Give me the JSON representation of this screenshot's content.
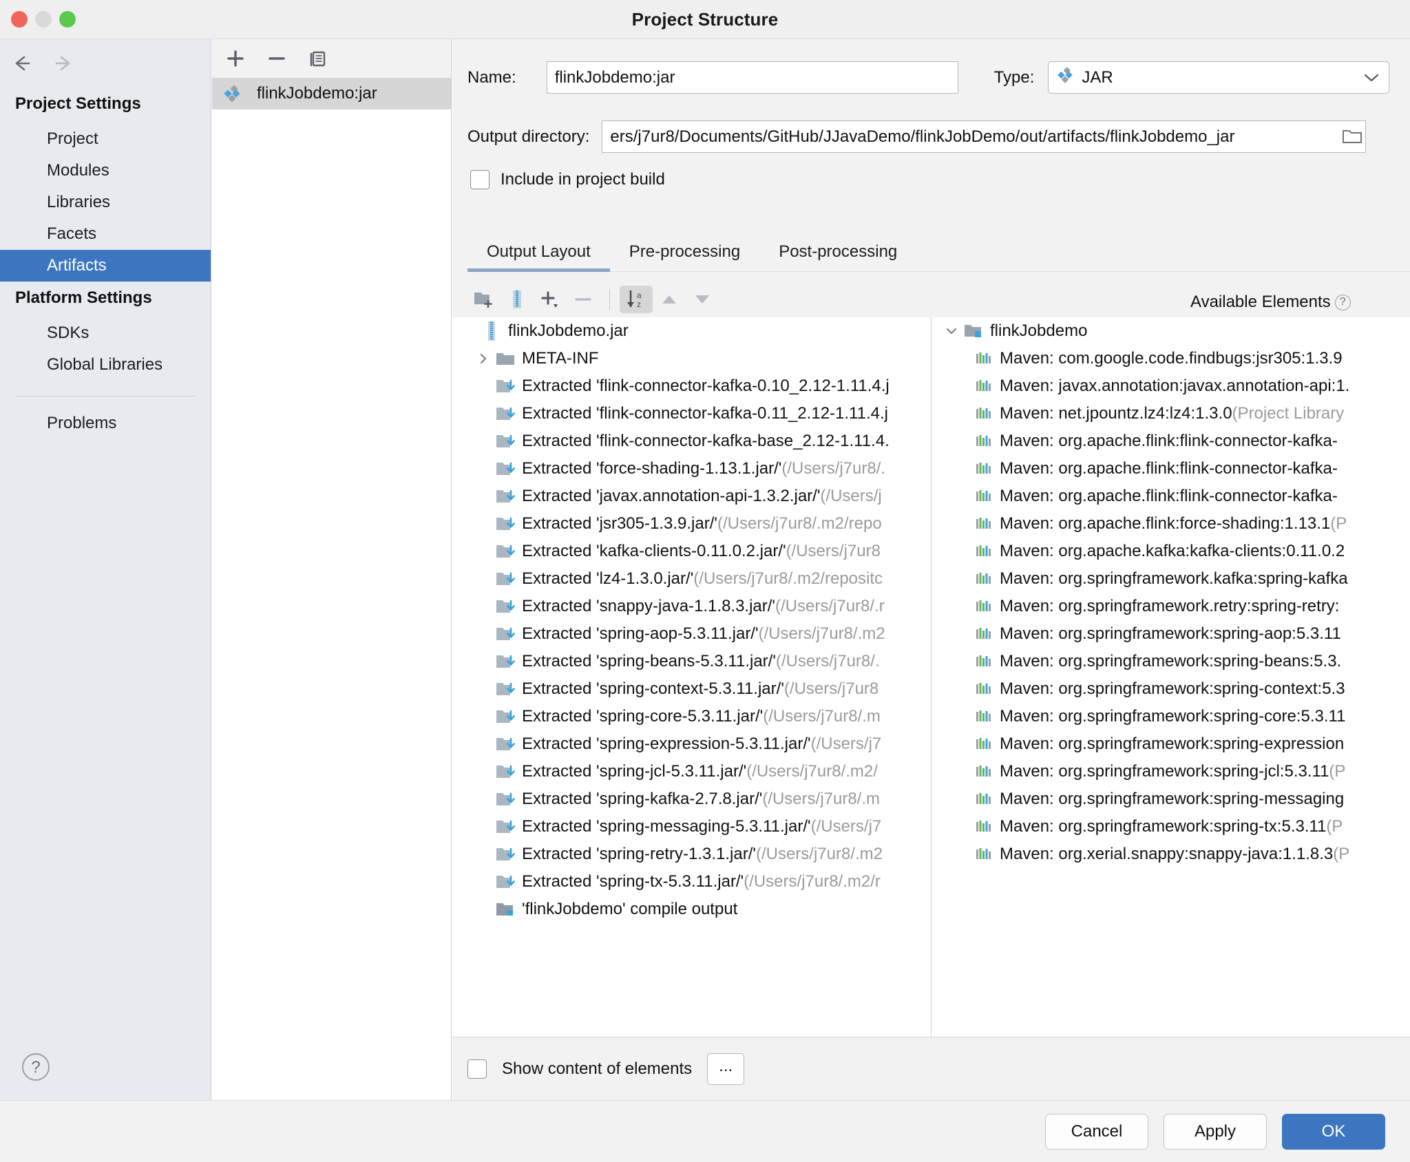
{
  "window": {
    "title": "Project Structure",
    "traffic_lights": [
      "close",
      "minimize",
      "maximize"
    ]
  },
  "sidebar": {
    "nav": {
      "back": "back-arrow",
      "forward": "forward-arrow"
    },
    "groups": [
      {
        "heading": "Project Settings",
        "items": [
          {
            "label": "Project",
            "selected": false
          },
          {
            "label": "Modules",
            "selected": false
          },
          {
            "label": "Libraries",
            "selected": false
          },
          {
            "label": "Facets",
            "selected": false
          },
          {
            "label": "Artifacts",
            "selected": true
          }
        ]
      },
      {
        "heading": "Platform Settings",
        "items": [
          {
            "label": "SDKs",
            "selected": false
          },
          {
            "label": "Global Libraries",
            "selected": false
          }
        ]
      }
    ],
    "extra_items": [
      {
        "label": "Problems",
        "selected": false
      }
    ],
    "help_label": "?"
  },
  "artifact_list": {
    "toolbar": [
      {
        "name": "add-artifact-button",
        "glyph": "+"
      },
      {
        "name": "remove-artifact-button",
        "glyph": "−"
      },
      {
        "name": "copy-artifact-button",
        "glyph": "copy"
      }
    ],
    "items": [
      {
        "label": "flinkJobdemo:jar",
        "selected": true,
        "icon": "artifact-icon"
      }
    ]
  },
  "details": {
    "name_label": "Name:",
    "name_value": "flinkJobdemo:jar",
    "type_label": "Type:",
    "type_value": "JAR",
    "output_dir_label": "Output directory:",
    "output_dir_value": "ers/j7ur8/Documents/GitHub/JJavaDemo/flinkJobDemo/out/artifacts/flinkJobdemo_jar",
    "include_in_build_label": "Include in project build",
    "include_in_build_checked": false,
    "tabs": [
      {
        "label": "Output Layout",
        "active": true
      },
      {
        "label": "Pre-processing",
        "active": false
      },
      {
        "label": "Post-processing",
        "active": false
      }
    ]
  },
  "layout_toolbar": [
    {
      "name": "create-directory-button",
      "glyph": "folder-plus"
    },
    {
      "name": "create-archive-button",
      "glyph": "archive"
    },
    {
      "name": "add-copy-of-button",
      "glyph": "plus-dropdown"
    },
    {
      "name": "remove-element-button",
      "glyph": "minus"
    },
    {
      "name": "sort-alphabetically-button",
      "glyph": "sort-az",
      "active": true
    },
    {
      "name": "move-up-button",
      "glyph": "triangle-up"
    },
    {
      "name": "move-down-button",
      "glyph": "triangle-down"
    }
  ],
  "available_elements": {
    "title": "Available Elements",
    "help_glyph": "?",
    "root": {
      "label": "flinkJobdemo",
      "expanded": true,
      "icon": "module-folder-icon"
    },
    "items": [
      {
        "label": "Maven: com.google.code.findbugs:jsr305:1.3.9",
        "suffix": ""
      },
      {
        "label": "Maven: javax.annotation:javax.annotation-api:1.",
        "suffix": ""
      },
      {
        "label": "Maven: net.jpountz.lz4:lz4:1.3.0",
        "suffix": " (Project Library"
      },
      {
        "label": "Maven: org.apache.flink:flink-connector-kafka-",
        "suffix": ""
      },
      {
        "label": "Maven: org.apache.flink:flink-connector-kafka-",
        "suffix": ""
      },
      {
        "label": "Maven: org.apache.flink:flink-connector-kafka-",
        "suffix": ""
      },
      {
        "label": "Maven: org.apache.flink:force-shading:1.13.1",
        "suffix": " (P"
      },
      {
        "label": "Maven: org.apache.kafka:kafka-clients:0.11.0.2",
        "suffix": ""
      },
      {
        "label": "Maven: org.springframework.kafka:spring-kafka",
        "suffix": ""
      },
      {
        "label": "Maven: org.springframework.retry:spring-retry:",
        "suffix": ""
      },
      {
        "label": "Maven: org.springframework:spring-aop:5.3.11",
        "suffix": ""
      },
      {
        "label": "Maven: org.springframework:spring-beans:5.3.",
        "suffix": ""
      },
      {
        "label": "Maven: org.springframework:spring-context:5.3",
        "suffix": ""
      },
      {
        "label": "Maven: org.springframework:spring-core:5.3.11",
        "suffix": ""
      },
      {
        "label": "Maven: org.springframework:spring-expression",
        "suffix": ""
      },
      {
        "label": "Maven: org.springframework:spring-jcl:5.3.11",
        "suffix": " (P"
      },
      {
        "label": "Maven: org.springframework:spring-messaging",
        "suffix": ""
      },
      {
        "label": "Maven: org.springframework:spring-tx:5.3.11",
        "suffix": " (P"
      },
      {
        "label": "Maven: org.xerial.snappy:snappy-java:1.1.8.3",
        "suffix": " (P"
      }
    ]
  },
  "output_layout_tree": [
    {
      "icon": "archive-icon",
      "indent": 0,
      "twisty": "none",
      "label": "flinkJobdemo.jar",
      "dim": ""
    },
    {
      "icon": "folder-icon",
      "indent": 1,
      "twisty": "collapsed",
      "label": "META-INF",
      "dim": ""
    },
    {
      "icon": "extracted-icon",
      "indent": 1,
      "twisty": "none",
      "label": "Extracted 'flink-connector-kafka-0.10_2.12-1.11.4.j",
      "dim": ""
    },
    {
      "icon": "extracted-icon",
      "indent": 1,
      "twisty": "none",
      "label": "Extracted 'flink-connector-kafka-0.11_2.12-1.11.4.j",
      "dim": ""
    },
    {
      "icon": "extracted-icon",
      "indent": 1,
      "twisty": "none",
      "label": "Extracted 'flink-connector-kafka-base_2.12-1.11.4.",
      "dim": ""
    },
    {
      "icon": "extracted-icon",
      "indent": 1,
      "twisty": "none",
      "label": "Extracted 'force-shading-1.13.1.jar/'",
      "dim": " (/Users/j7ur8/."
    },
    {
      "icon": "extracted-icon",
      "indent": 1,
      "twisty": "none",
      "label": "Extracted 'javax.annotation-api-1.3.2.jar/'",
      "dim": " (/Users/j"
    },
    {
      "icon": "extracted-icon",
      "indent": 1,
      "twisty": "none",
      "label": "Extracted 'jsr305-1.3.9.jar/'",
      "dim": " (/Users/j7ur8/.m2/repo"
    },
    {
      "icon": "extracted-icon",
      "indent": 1,
      "twisty": "none",
      "label": "Extracted 'kafka-clients-0.11.0.2.jar/'",
      "dim": " (/Users/j7ur8"
    },
    {
      "icon": "extracted-icon",
      "indent": 1,
      "twisty": "none",
      "label": "Extracted 'lz4-1.3.0.jar/'",
      "dim": " (/Users/j7ur8/.m2/repositc"
    },
    {
      "icon": "extracted-icon",
      "indent": 1,
      "twisty": "none",
      "label": "Extracted 'snappy-java-1.1.8.3.jar/'",
      "dim": " (/Users/j7ur8/.r"
    },
    {
      "icon": "extracted-icon",
      "indent": 1,
      "twisty": "none",
      "label": "Extracted 'spring-aop-5.3.11.jar/'",
      "dim": " (/Users/j7ur8/.m2"
    },
    {
      "icon": "extracted-icon",
      "indent": 1,
      "twisty": "none",
      "label": "Extracted 'spring-beans-5.3.11.jar/'",
      "dim": " (/Users/j7ur8/."
    },
    {
      "icon": "extracted-icon",
      "indent": 1,
      "twisty": "none",
      "label": "Extracted 'spring-context-5.3.11.jar/'",
      "dim": " (/Users/j7ur8"
    },
    {
      "icon": "extracted-icon",
      "indent": 1,
      "twisty": "none",
      "label": "Extracted 'spring-core-5.3.11.jar/'",
      "dim": " (/Users/j7ur8/.m"
    },
    {
      "icon": "extracted-icon",
      "indent": 1,
      "twisty": "none",
      "label": "Extracted 'spring-expression-5.3.11.jar/'",
      "dim": " (/Users/j7"
    },
    {
      "icon": "extracted-icon",
      "indent": 1,
      "twisty": "none",
      "label": "Extracted 'spring-jcl-5.3.11.jar/'",
      "dim": " (/Users/j7ur8/.m2/"
    },
    {
      "icon": "extracted-icon",
      "indent": 1,
      "twisty": "none",
      "label": "Extracted 'spring-kafka-2.7.8.jar/'",
      "dim": " (/Users/j7ur8/.m"
    },
    {
      "icon": "extracted-icon",
      "indent": 1,
      "twisty": "none",
      "label": "Extracted 'spring-messaging-5.3.11.jar/'",
      "dim": " (/Users/j7"
    },
    {
      "icon": "extracted-icon",
      "indent": 1,
      "twisty": "none",
      "label": "Extracted 'spring-retry-1.3.1.jar/'",
      "dim": " (/Users/j7ur8/.m2"
    },
    {
      "icon": "extracted-icon",
      "indent": 1,
      "twisty": "none",
      "label": "Extracted 'spring-tx-5.3.11.jar/'",
      "dim": " (/Users/j7ur8/.m2/r"
    },
    {
      "icon": "compile-output-icon",
      "indent": 1,
      "twisty": "none",
      "label": "'flinkJobdemo' compile output",
      "dim": ""
    }
  ],
  "pane_bottom": {
    "show_content_label": "Show content of elements",
    "show_content_checked": false,
    "more_label": "..."
  },
  "footer": {
    "buttons": [
      {
        "label": "Cancel",
        "primary": false
      },
      {
        "label": "Apply",
        "primary": false
      },
      {
        "label": "OK",
        "primary": true
      }
    ]
  },
  "colors": {
    "accent": "#3d76c0",
    "sidebar_bg": "#e7eaee",
    "panel_bg": "#f2f2f2",
    "selection_gray": "#d6d6d6",
    "dim_text": "#9a9a9a"
  }
}
